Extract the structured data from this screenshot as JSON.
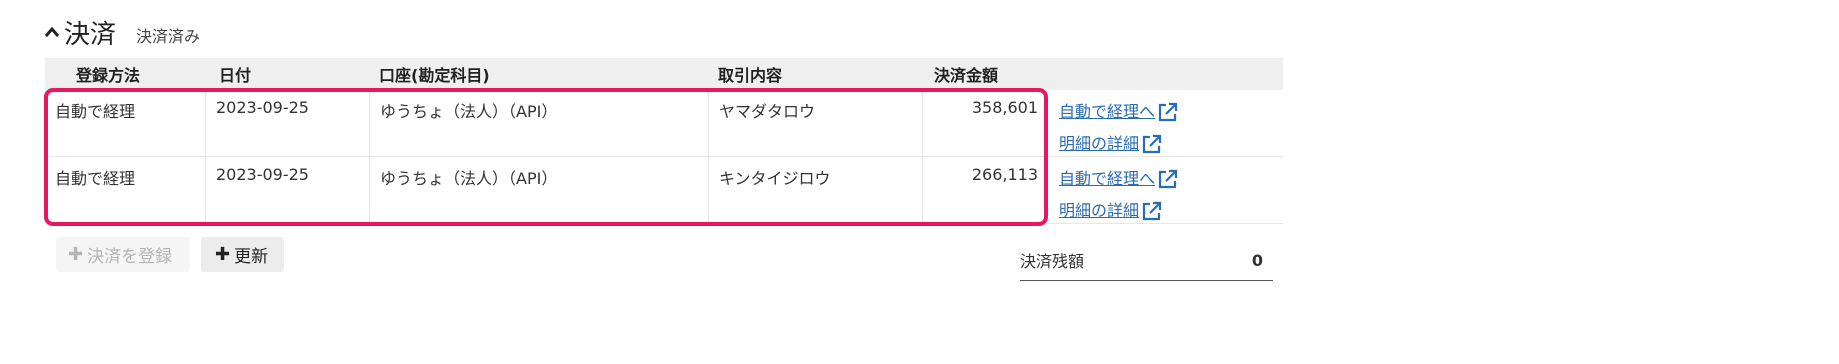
{
  "section": {
    "title": "決済",
    "status": "決済済み"
  },
  "table": {
    "headers": [
      "登録方法",
      "日付",
      "口座(勘定科目)",
      "取引内容",
      "決済金額"
    ],
    "rows": [
      {
        "method": "自動で経理",
        "date": "2023-09-25",
        "account": "ゆうちょ（法人）（API）",
        "description": "ヤマダタロウ",
        "amount": "358,601",
        "link_auto": "自動で経理へ",
        "link_detail": "明細の詳細"
      },
      {
        "method": "自動で経理",
        "date": "2023-09-25",
        "account": "ゆうちょ（法人）（API）",
        "description": "キンタイジロウ",
        "amount": "266,113",
        "link_auto": "自動で経理へ",
        "link_detail": "明細の詳細"
      }
    ]
  },
  "buttons": {
    "register_label": "決済を登録",
    "refresh_label": "更新"
  },
  "balance": {
    "label": "決済残額",
    "value": "0"
  },
  "icons": {
    "collapse": "chevron-up-icon",
    "external": "external-link-icon",
    "plus": "plus-icon"
  },
  "colors": {
    "highlight": "#e8185c",
    "link": "#2a6cb4"
  }
}
